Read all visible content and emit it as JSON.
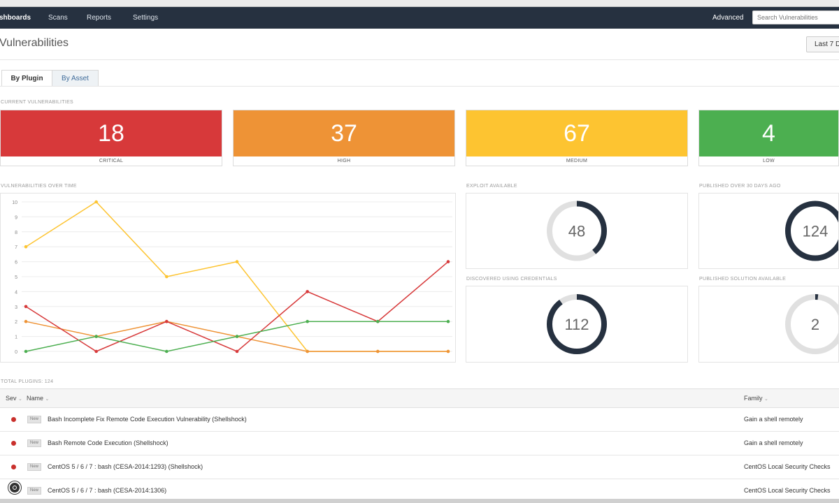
{
  "nav": {
    "items": [
      "shboards",
      "Scans",
      "Reports",
      "Settings"
    ],
    "advanced": "Advanced",
    "search_placeholder": "Search Vulnerabilities"
  },
  "page": {
    "title": "Vulnerabilities",
    "date_range": "Last 7 D"
  },
  "tabs": [
    "By Plugin",
    "By Asset"
  ],
  "current_label": "CURRENT VULNERABILITIES",
  "stats": [
    {
      "value": "18",
      "label": "CRITICAL",
      "color": "#d7393a"
    },
    {
      "value": "37",
      "label": "HIGH",
      "color": "#ee9336"
    },
    {
      "value": "67",
      "label": "MEDIUM",
      "color": "#fdc431"
    },
    {
      "value": "4",
      "label": "LOW",
      "color": "#4caf50"
    }
  ],
  "chart_label": "VULNERABILITIES OVER TIME",
  "chart_data": {
    "type": "line",
    "x": [
      1,
      2,
      3,
      4,
      5,
      6,
      7
    ],
    "ylim": [
      0,
      10
    ],
    "yticks": [
      "0",
      "1",
      "2",
      "3",
      "4",
      "5",
      "6",
      "7",
      "8",
      "9",
      "10"
    ],
    "grid": true,
    "series": [
      {
        "color": "#fdc431",
        "values": [
          7,
          10,
          5,
          6,
          0,
          0,
          0
        ]
      },
      {
        "color": "#ee9336",
        "values": [
          2,
          1,
          2,
          1,
          0,
          0,
          0
        ]
      },
      {
        "color": "#d7393a",
        "values": [
          3,
          0,
          2,
          0,
          4,
          2,
          6
        ]
      },
      {
        "color": "#4caf50",
        "values": [
          0,
          1,
          0,
          1,
          2,
          2,
          2
        ]
      }
    ]
  },
  "donuts": [
    {
      "title": "EXPLOIT AVAILABLE",
      "value": "48",
      "fraction": 0.39
    },
    {
      "title": "PUBLISHED OVER 30 DAYS AGO",
      "value": "124",
      "fraction": 1.0
    },
    {
      "title": "DISCOVERED USING CREDENTIALS",
      "value": "112",
      "fraction": 0.9
    },
    {
      "title": "PUBLISHED SOLUTION AVAILABLE",
      "value": "2",
      "fraction": 0.016
    }
  ],
  "table": {
    "total_label": "TOTAL PLUGINS: 124",
    "headers": {
      "sev": "Sev",
      "name": "Name",
      "family": "Family"
    },
    "rows": [
      {
        "badge": "New",
        "name": "Bash Incomplete Fix Remote Code Execution Vulnerability (Shellshock)",
        "family": "Gain a shell remotely"
      },
      {
        "badge": "New",
        "name": "Bash Remote Code Execution (Shellshock)",
        "family": "Gain a shell remotely"
      },
      {
        "badge": "New",
        "name": "CentOS 5 / 6 / 7 : bash (CESA-2014:1293) (Shellshock)",
        "family": "CentOS Local Security Checks"
      },
      {
        "badge": "New",
        "name": "CentOS 5 / 6 / 7 : bash (CESA-2014:1306)",
        "family": "CentOS Local Security Checks"
      }
    ]
  },
  "colors": {
    "navbar": "#263140",
    "donut_active": "#263140",
    "donut_track": "#e0e0e0",
    "severity_critical_dot": "#c9302c"
  }
}
